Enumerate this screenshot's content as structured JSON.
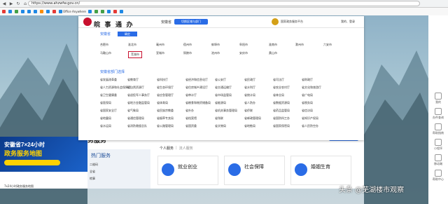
{
  "browser": {
    "url": "https://www.ahzwfw.gov.cn/",
    "bookmarks": [
      {
        "label": "",
        "color": "#e53935"
      },
      {
        "label": "",
        "color": "#1e88e5"
      },
      {
        "label": "",
        "color": "#43a047"
      },
      {
        "label": "",
        "color": "#1e88e5"
      },
      {
        "label": "",
        "color": "#1e88e5"
      },
      {
        "label": "",
        "color": "#1e88e5"
      },
      {
        "label": "",
        "color": "#fb8c00"
      },
      {
        "label": "",
        "color": "#1e88e5"
      },
      {
        "label": "",
        "color": "#e53935"
      },
      {
        "label": "Office Anywhere",
        "color": "#1e88e5"
      },
      {
        "label": "",
        "color": "#1e88e5"
      },
      {
        "label": "",
        "color": "#43a047"
      },
      {
        "label": "",
        "color": "#43a047"
      },
      {
        "label": "",
        "color": "#1e88e5"
      },
      {
        "label": "",
        "color": "#e53935"
      },
      {
        "label": "",
        "color": "#1e88e5"
      }
    ]
  },
  "popup": {
    "logo_main": "皖 事 通 办",
    "logo_sub": "",
    "region": "安徽省",
    "switch_label": "切换区域与部门",
    "national_label": "国家政务服务平台",
    "login_label": "我的、登录",
    "province": "安徽省",
    "confirm_label": "确定",
    "cities": [
      {
        "name": "合肥市"
      },
      {
        "name": "淮北市"
      },
      {
        "name": "亳州市"
      },
      {
        "name": "宿州市"
      },
      {
        "name": "蚌埠市"
      },
      {
        "name": "阜阳市"
      },
      {
        "name": "淮南市"
      },
      {
        "name": "滁州市"
      },
      {
        "name": "六安市"
      },
      {
        "name": "马鞍山市"
      },
      {
        "name": "芜湖市"
      },
      {
        "name": "宣城市"
      },
      {
        "name": "铜陵市"
      },
      {
        "name": "池州市"
      },
      {
        "name": "安庆市"
      },
      {
        "name": "黄山市"
      }
    ],
    "selected_city": "芜湖市",
    "dept_title": "安徽省部门选择",
    "depts": [
      "省发展改革委",
      "省教育厅",
      "省科技厅",
      "省经济和信息化厅",
      "省公安厅",
      "省民政厅",
      "省司法厅",
      "省财政厅",
      "省人力资源和社会保障厅",
      "省自然资源厅",
      "省生态环境厅",
      "省住房城乡建设厅",
      "省交通运输厅",
      "省水利厅",
      "省农业农村厅",
      "省文化和旅游厅",
      "省卫生健康委",
      "省退役军人事务厅",
      "省应急管理厅",
      "省审计厅",
      "省市场监管局",
      "省统计局",
      "省林业局",
      "省广电局",
      "省医保局",
      "省地方金融监管局",
      "省体育局",
      "省粮食和物资储备局",
      "省能源局",
      "省人防办",
      "省数据资源局",
      "省税务局",
      "省国家安全厅",
      "省气象局",
      "省民族宗教委",
      "省外办",
      "省机关事务管理局",
      "省侨联",
      "省药品监管局",
      "省信访局",
      "省地震局",
      "省通信管理局",
      "省烟草专卖局",
      "省档案馆",
      "省残联",
      "省邮政管理局",
      "省国防科工办",
      "省知识产权局",
      "省水运局",
      "省消防救援总队",
      "省公路管理局",
      "省国资委",
      "省文物局",
      "省地勘局",
      "省国家保密局",
      "省人民防空办"
    ]
  },
  "left_banner": {
    "line1": "安徽省7×24小时",
    "line2": "政务服务地图",
    "caption": "7x24小时政务服务地图"
  },
  "services": {
    "title": "务服务",
    "more_btn": "更多服务",
    "hot_title": "热门服务",
    "hot_items": [
      "二维码",
      "全省",
      "皖事"
    ],
    "tab_personal": "个人服务",
    "tab_legal": "法人服务",
    "cards": [
      {
        "title": "就业创业",
        "subtitle": "",
        "color": "#2a6ce6"
      },
      {
        "title": "社会保障",
        "subtitle": "",
        "color": "#2a6ce6"
      },
      {
        "title": "婚姻生育",
        "subtitle": "",
        "color": "#2a6ce6"
      }
    ]
  },
  "right_sidebar": [
    {
      "label": "我的"
    },
    {
      "label": "办件查询"
    },
    {
      "label": "帮助指南"
    },
    {
      "label": "小程序"
    },
    {
      "label": "移动端"
    },
    {
      "label": "帮助中心"
    }
  ],
  "watermark": "头条 @芜湖楼市观察"
}
